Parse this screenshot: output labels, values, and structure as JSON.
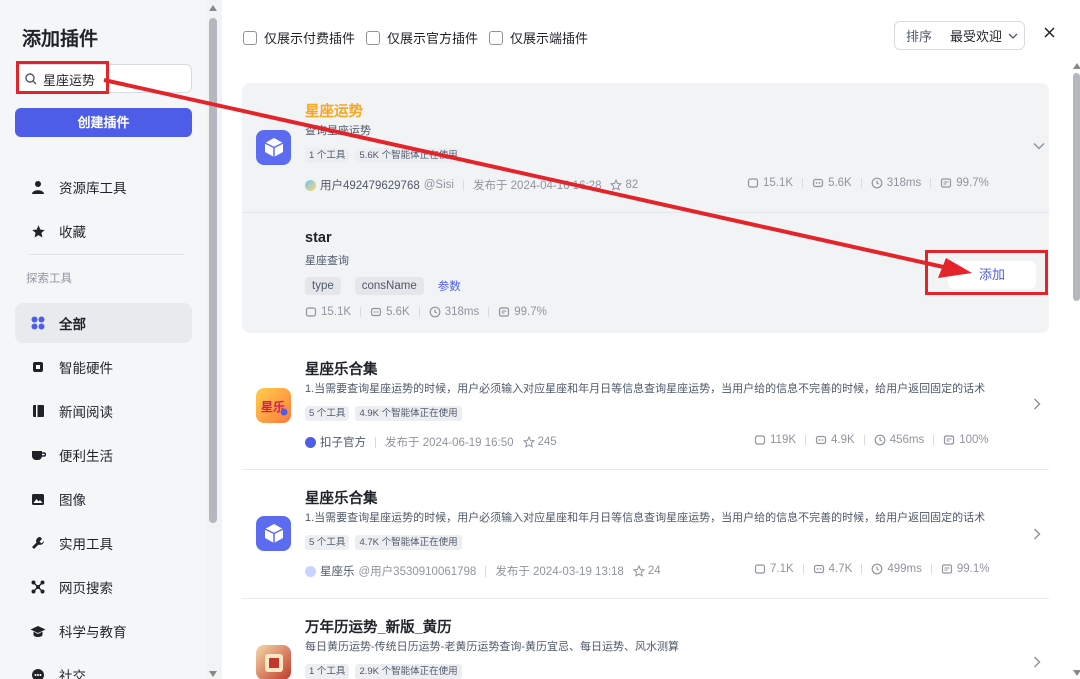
{
  "sidebar": {
    "title": "添加插件",
    "search_value": "星座运势",
    "create_label": "创建插件",
    "nav_top": [
      {
        "label": "资源库工具",
        "icon": "person-icon"
      },
      {
        "label": "收藏",
        "icon": "star-icon"
      }
    ],
    "section_label": "探索工具",
    "nav_explore": [
      {
        "label": "全部",
        "icon": "grid-icon",
        "active": true
      },
      {
        "label": "智能硬件",
        "icon": "chip-icon"
      },
      {
        "label": "新闻阅读",
        "icon": "book-icon"
      },
      {
        "label": "便利生活",
        "icon": "cup-icon"
      },
      {
        "label": "图像",
        "icon": "image-icon"
      },
      {
        "label": "实用工具",
        "icon": "wrench-icon"
      },
      {
        "label": "网页搜索",
        "icon": "network-icon"
      },
      {
        "label": "科学与教育",
        "icon": "graduation-cap-icon"
      },
      {
        "label": "社交",
        "icon": "chat-icon"
      }
    ]
  },
  "filters": {
    "paid_only": "仅展示付费插件",
    "official_only": "仅展示官方插件",
    "cloud_only": "仅展示端插件"
  },
  "sort": {
    "label": "排序",
    "value": "最受欢迎"
  },
  "plugins": [
    {
      "name": "星座运势",
      "desc": "查询星座运势",
      "tools": "1 个工具",
      "usage": "5.6K 个智能体正在使用",
      "author": "用户492479629768",
      "handle": "@Sisi",
      "published": "发布于 2024-04-16 16:28",
      "stars": "82",
      "calls": "15.1K",
      "bots": "5.6K",
      "latency": "318ms",
      "success": "99.7%"
    },
    {
      "name": "星座乐合集",
      "desc": "1.当需要查询星座运势的时候，用户必须输入对应星座和年月日等信息查询星座运势，当用户给的信息不完善的时候，给用户返回固定的话术",
      "tools": "5 个工具",
      "usage": "4.9K 个智能体正在使用",
      "author": "扣子官方",
      "handle": "",
      "published": "发布于 2024-06-19 16:50",
      "stars": "245",
      "calls": "119K",
      "bots": "4.9K",
      "latency": "456ms",
      "success": "100%"
    },
    {
      "name": "星座乐合集",
      "desc": "1.当需要查询星座运势的时候，用户必须输入对应星座和年月日等信息查询星座运势，当用户给的信息不完善的时候，给用户返回固定的话术",
      "tools": "5 个工具",
      "usage": "4.7K 个智能体正在使用",
      "author": "星座乐",
      "handle": "@用户3530910061798",
      "published": "发布于 2024-03-19 13:18",
      "stars": "24",
      "calls": "7.1K",
      "bots": "4.7K",
      "latency": "499ms",
      "success": "99.1%"
    },
    {
      "name": "万年历运势_新版_黄历",
      "desc": "每日黄历运势-传统日历运势-老黄历运势查询-黄历宜忌、每日运势、风水测算",
      "tools": "1 个工具",
      "usage": "2.9K 个智能体正在使用"
    }
  ],
  "tool": {
    "name": "star",
    "desc": "星座查询",
    "params": [
      "type",
      "consName"
    ],
    "params_link": "参数",
    "calls": "15.1K",
    "bots": "5.6K",
    "latency": "318ms",
    "success": "99.7%",
    "add_label": "添加"
  },
  "colors": {
    "accent": "#4e5de8",
    "annotation": "#e3242b",
    "highlight_name": "#f5a623"
  }
}
